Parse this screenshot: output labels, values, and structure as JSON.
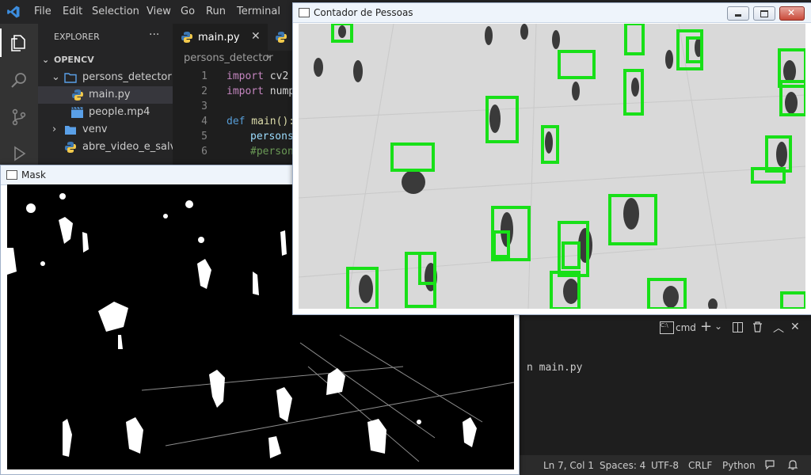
{
  "vscode": {
    "menu": [
      "File",
      "Edit",
      "Selection",
      "View",
      "Go",
      "Run",
      "Terminal"
    ],
    "explorer": {
      "header": "EXPLORER",
      "more": "···",
      "root": "OPENCV",
      "items": [
        {
          "label": "persons_detector",
          "kind": "folder-open"
        },
        {
          "label": "main.py",
          "kind": "python"
        },
        {
          "label": "people.mp4",
          "kind": "video"
        },
        {
          "label": "venv",
          "kind": "folder"
        },
        {
          "label": "abre_video_e_salv...",
          "kind": "python"
        }
      ]
    },
    "tabs": [
      {
        "label": "main.py",
        "active": true
      },
      {
        "label": "",
        "active": false
      }
    ],
    "breadcrumb": "persons_detector",
    "code": {
      "line_numbers": [
        "1",
        "2",
        "3",
        "4",
        "5",
        "6"
      ],
      "lines": [
        {
          "kw": "import",
          "rest": " cv2"
        },
        {
          "kw": "import",
          "rest": " nump"
        },
        {
          "kw": "",
          "rest": ""
        },
        {
          "kw": "def",
          "rest": " main():"
        },
        {
          "kw": "",
          "rest": "persons"
        },
        {
          "kw": "",
          "rest": "#person"
        }
      ]
    },
    "terminal": {
      "shell": "cmd",
      "command": "n main.py"
    },
    "status": {
      "position": "Ln 7, Col 1",
      "spaces": "Spaces: 4",
      "encoding": "UTF-8",
      "eol": "CRLF",
      "language": "Python"
    }
  },
  "windows": {
    "mask": {
      "title": "Mask"
    },
    "counter": {
      "title": "Contador de Pessoas"
    }
  },
  "colors": {
    "vscode_blue": "#3c8dde",
    "detection_box": "#18e018",
    "mask_foreground": "#ffffff",
    "mask_background": "#000000"
  }
}
